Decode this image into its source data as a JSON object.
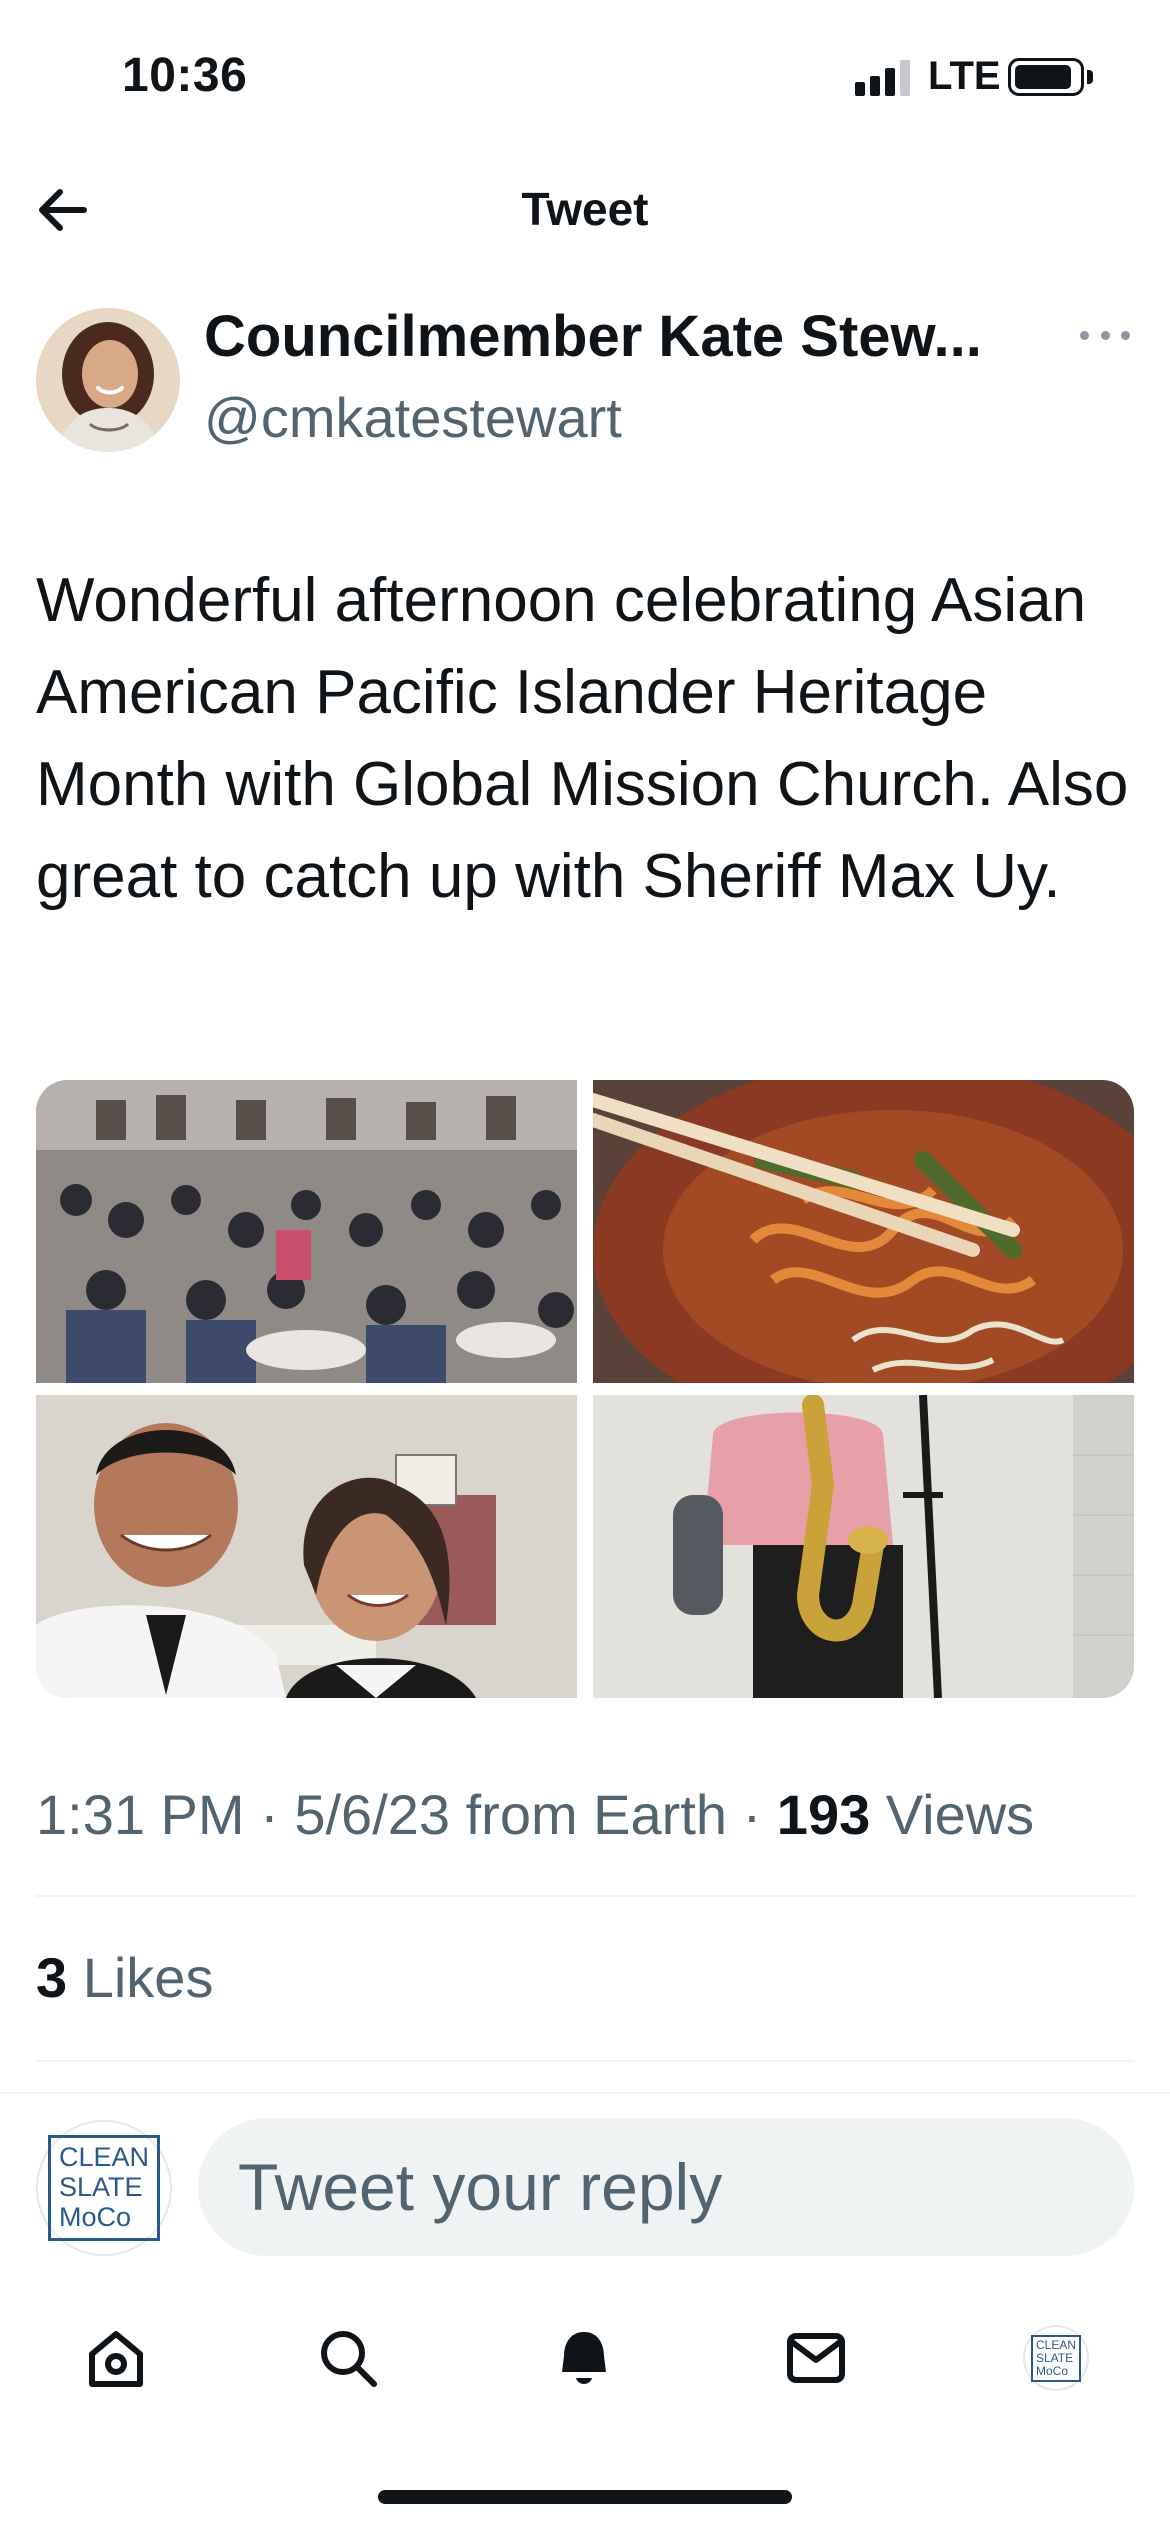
{
  "status_bar": {
    "time": "10:36",
    "network": "LTE"
  },
  "header": {
    "title": "Tweet"
  },
  "tweet": {
    "author_name": "Councilmember Kate Stew...",
    "author_handle": "@cmkatestewart",
    "text": "Wonderful afternoon celebrating Asian American Pacific Islander Heritage Month with Global Mission Church. Also great to catch up with Sheriff Max Uy.",
    "time": "1:31 PM",
    "date": "5/6/23",
    "source": "from Earth",
    "views_count": "193",
    "views_label": "Views",
    "likes_count": "3",
    "likes_label": "Likes"
  },
  "reply": {
    "placeholder": "Tweet your reply",
    "avatar_logo": [
      "CLEAN",
      "SLATE",
      "MoCo"
    ]
  },
  "nav": {
    "items": [
      "home-icon",
      "search-icon",
      "notifications-icon",
      "messages-icon",
      "profile-avatar"
    ]
  },
  "colors": {
    "text_primary": "#0f1419",
    "text_secondary": "#536471",
    "input_bg": "#eff3f4",
    "divider": "#eff3f4",
    "logo_blue": "#2a5a8a"
  }
}
